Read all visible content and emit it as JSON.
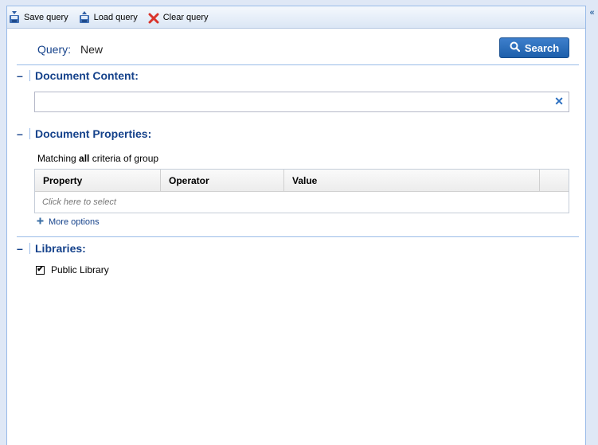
{
  "toolbar": {
    "save_label": "Save query",
    "load_label": "Load query",
    "clear_label": "Clear query",
    "collapse_glyph": "«"
  },
  "query": {
    "label": "Query:",
    "value": "New"
  },
  "search_button": {
    "label": "Search"
  },
  "document_content": {
    "title": "Document Content:",
    "toggle": "–",
    "input_value": "",
    "clear_glyph": "✕"
  },
  "document_properties": {
    "title": "Document Properties:",
    "toggle": "–",
    "match_prefix": "Matching ",
    "match_mode": "all",
    "match_suffix": " criteria of group",
    "columns": [
      "Property",
      "Operator",
      "Value",
      ""
    ],
    "placeholder_row": "Click here to select",
    "more_options": "More options"
  },
  "libraries": {
    "title": "Libraries:",
    "toggle": "–",
    "items": [
      {
        "label": "Public Library",
        "checked": true,
        "check_glyph": "✔"
      }
    ]
  },
  "colors": {
    "accent": "#15428b",
    "button": "#2a6cbf",
    "border": "#99bbe8"
  },
  "icons": {
    "save": "save-disk-icon",
    "load": "load-disk-icon",
    "clear": "red-x-icon",
    "search": "magnifier-icon",
    "more": "plus-icon"
  }
}
